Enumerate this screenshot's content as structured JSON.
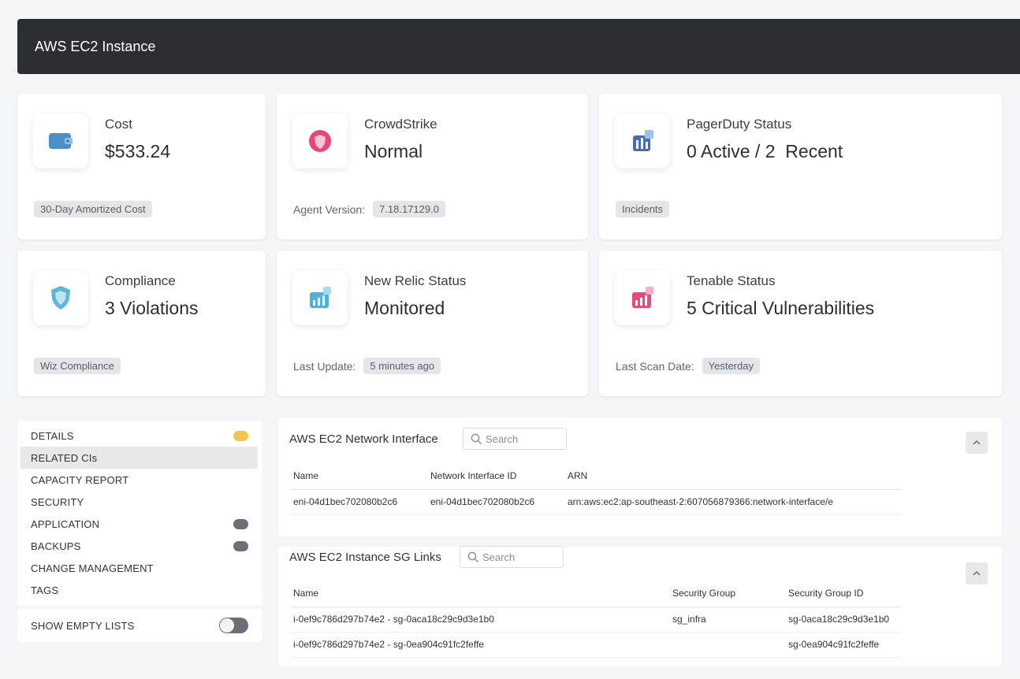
{
  "header": {
    "title": "AWS EC2 Instance"
  },
  "cards": [
    {
      "id": "cost",
      "label": "Cost",
      "value": "$533.24",
      "footer_label": "",
      "footer_chip": "30-Day Amortized Cost",
      "icon": "wallet-icon",
      "icon_color": "#4a90c8"
    },
    {
      "id": "crowdstrike",
      "label": "CrowdStrike",
      "value": "Normal",
      "footer_label": "Agent Version:",
      "footer_chip": "7.18.17129.0",
      "icon": "shield-circle-icon",
      "icon_color": "#e8457a"
    },
    {
      "id": "pagerduty",
      "label": "PagerDuty Status",
      "value": "0 Active / 2  Recent",
      "footer_label": "",
      "footer_chip": "Incidents",
      "icon": "pager-chart-icon",
      "icon_color": "#4a6fa8"
    },
    {
      "id": "compliance",
      "label": "Compliance",
      "value": "3 Violations",
      "footer_label": "",
      "footer_chip": "Wiz Compliance",
      "icon": "shield-icon",
      "icon_color": "#5fb6d8"
    },
    {
      "id": "newrelic",
      "label": "New Relic Status",
      "value": "Monitored",
      "footer_label": "Last Update:",
      "footer_chip": "5 minutes ago",
      "icon": "bar-chart-icon",
      "icon_color": "#4fb0d8"
    },
    {
      "id": "tenable",
      "label": "Tenable Status",
      "value": "5 Critical Vulnerabilities",
      "footer_label": "Last Scan Date:",
      "footer_chip": "Yesterday",
      "icon": "bar-chart-icon",
      "icon_color": "#e84a7a"
    }
  ],
  "sidebar": {
    "items": [
      {
        "label": "DETAILS",
        "active": false,
        "indicator": "yellow"
      },
      {
        "label": "RELATED CIs",
        "active": true,
        "indicator": ""
      },
      {
        "label": "CAPACITY REPORT",
        "active": false,
        "indicator": ""
      },
      {
        "label": "SECURITY",
        "active": false,
        "indicator": ""
      },
      {
        "label": "APPLICATION",
        "active": false,
        "indicator": "gray"
      },
      {
        "label": "BACKUPS",
        "active": false,
        "indicator": "gray"
      },
      {
        "label": "CHANGE MANAGEMENT",
        "active": false,
        "indicator": ""
      },
      {
        "label": "TAGS",
        "active": false,
        "indicator": ""
      }
    ],
    "show_empty_label": "SHOW EMPTY LISTS",
    "show_empty_on": false
  },
  "network_panel": {
    "title": "AWS EC2 Network Interface",
    "search_placeholder": "Search",
    "columns": [
      "Name",
      "Network Interface ID",
      "ARN"
    ],
    "rows": [
      [
        "eni-04d1bec702080b2c6",
        "eni-04d1bec702080b2c6",
        "arn:aws:ec2:ap-southeast-2:607056879366:network-interface/e"
      ]
    ]
  },
  "sg_panel": {
    "title": "AWS EC2 Instance SG Links",
    "search_placeholder": "Search",
    "columns": [
      "Name",
      "Security Group",
      "Security Group ID"
    ],
    "rows": [
      [
        "i-0ef9c786d297b74e2 - sg-0aca18c29c9d3e1b0",
        "sg_infra",
        "sg-0aca18c29c9d3e1b0"
      ],
      [
        "i-0ef9c786d297b74e2 - sg-0ea904c91fc2feffe",
        "",
        "sg-0ea904c91fc2feffe"
      ]
    ]
  }
}
